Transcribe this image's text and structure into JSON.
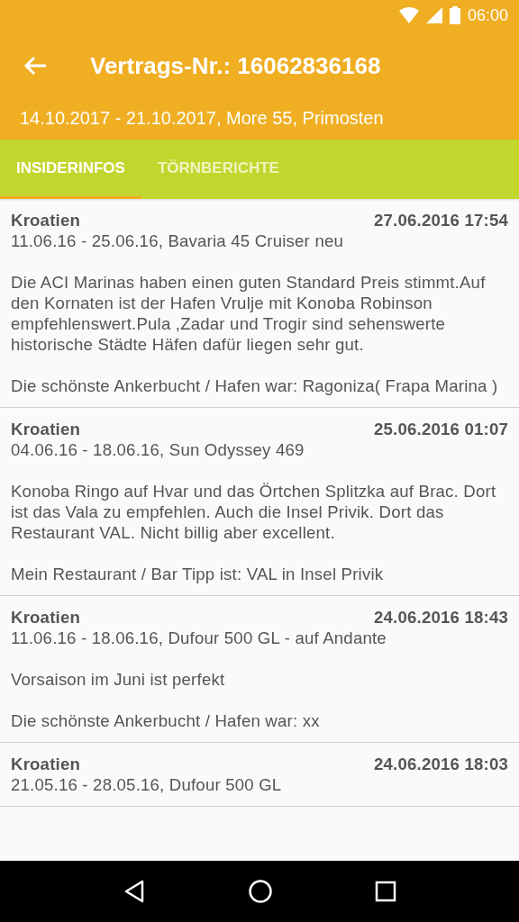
{
  "status_bar": {
    "time": "06:00"
  },
  "app_bar": {
    "title": "Vertrags-Nr.: 16062836168",
    "subtitle": "14.10.2017 - 21.10.2017, More 55, Primosten"
  },
  "tabs": [
    {
      "label": "INSIDERINFOS",
      "selected": true
    },
    {
      "label": "TÖRNBERICHTE",
      "selected": false
    }
  ],
  "entries": [
    {
      "region": "Kroatien",
      "date": "27.06.2016 17:54",
      "trip": "11.06.16 - 25.06.16, Bavaria 45 Cruiser neu",
      "paragraphs": [
        "Die ACI Marinas haben einen guten Standard Preis stimmt.Auf den Kornaten ist der Hafen Vrulje mit Konoba Robinson empfehlenswert.Pula ,Zadar und Trogir sind sehenswerte historische Städte Häfen dafür liegen sehr gut.",
        "Die schönste Ankerbucht / Hafen war: Ragoniza( Frapa Marina )"
      ]
    },
    {
      "region": "Kroatien",
      "date": "25.06.2016 01:07",
      "trip": "04.06.16 - 18.06.16, Sun Odyssey 469",
      "paragraphs": [
        "Konoba Ringo auf Hvar und das Örtchen Splitzka auf Brac. Dort ist das Vala zu empfehlen. Auch die Insel Privik. Dort das Restaurant VAL. Nicht billig aber excellent.",
        "Mein Restaurant / Bar Tipp ist: VAL in Insel Privik"
      ]
    },
    {
      "region": "Kroatien",
      "date": "24.06.2016 18:43",
      "trip": "11.06.16 - 18.06.16, Dufour 500 GL - auf Andante",
      "paragraphs": [
        "Vorsaison im Juni ist perfekt",
        "Die schönste Ankerbucht / Hafen war: xx"
      ]
    },
    {
      "region": "Kroatien",
      "date": "24.06.2016 18:03",
      "trip": "21.05.16 - 28.05.16, Dufour 500 GL"
    }
  ]
}
